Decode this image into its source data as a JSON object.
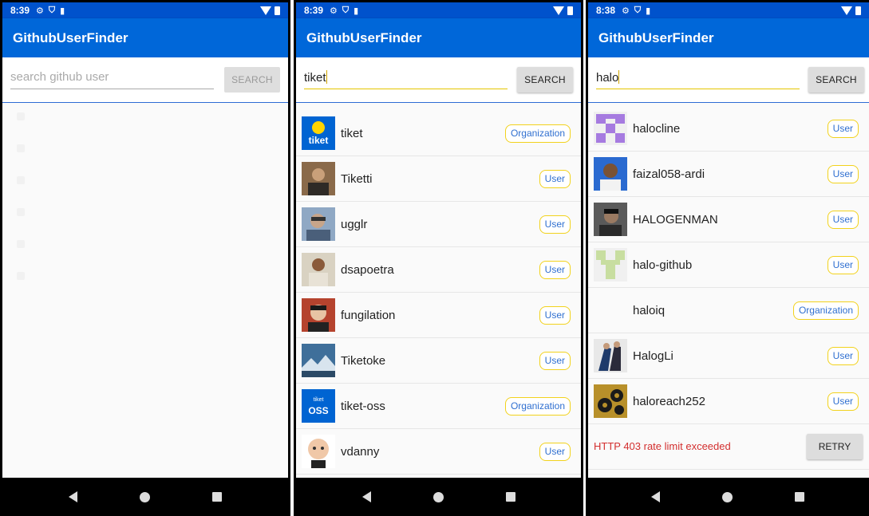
{
  "screens": [
    {
      "status": {
        "time": "8:39"
      },
      "app_title": "GithubUserFinder",
      "search": {
        "placeholder": "search github user",
        "value": "",
        "button": "SEARCH"
      }
    },
    {
      "status": {
        "time": "8:39"
      },
      "app_title": "GithubUserFinder",
      "search": {
        "placeholder": "",
        "value": "tiket",
        "button": "SEARCH"
      },
      "users": [
        {
          "name": "tiket",
          "type": "Organization",
          "avatar": "tiket-logo"
        },
        {
          "name": "Tiketti",
          "type": "User",
          "avatar": "photo"
        },
        {
          "name": "ugglr",
          "type": "User",
          "avatar": "photo"
        },
        {
          "name": "dsapoetra",
          "type": "User",
          "avatar": "photo"
        },
        {
          "name": "fungilation",
          "type": "User",
          "avatar": "photo"
        },
        {
          "name": "Tiketoke",
          "type": "User",
          "avatar": "landscape"
        },
        {
          "name": "tiket-oss",
          "type": "Organization",
          "avatar": "tiket-oss-logo"
        },
        {
          "name": "vdanny",
          "type": "User",
          "avatar": "baby"
        }
      ]
    },
    {
      "status": {
        "time": "8:38"
      },
      "app_title": "GithubUserFinder",
      "search": {
        "placeholder": "",
        "value": "halo",
        "button": "SEARCH"
      },
      "users": [
        {
          "name": "halocline",
          "type": "User",
          "avatar": "identicon-purple"
        },
        {
          "name": "faizal058-ardi",
          "type": "User",
          "avatar": "photo"
        },
        {
          "name": "HALOGENMAN",
          "type": "User",
          "avatar": "photo"
        },
        {
          "name": "halo-github",
          "type": "User",
          "avatar": "identicon-green"
        },
        {
          "name": "haloiq",
          "type": "Organization",
          "avatar": "blank"
        },
        {
          "name": "HalogLi",
          "type": "User",
          "avatar": "photo"
        },
        {
          "name": "haloreach252",
          "type": "User",
          "avatar": "gears"
        }
      ],
      "error": {
        "message": "HTTP 403 rate limit exceeded",
        "button": "RETRY"
      }
    }
  ],
  "colors": {
    "statusbar": "#0052cc",
    "appbar": "#0067d9",
    "badge_border": "#f2d21c",
    "badge_text": "#2f6fd0",
    "error": "#d32f2f"
  }
}
